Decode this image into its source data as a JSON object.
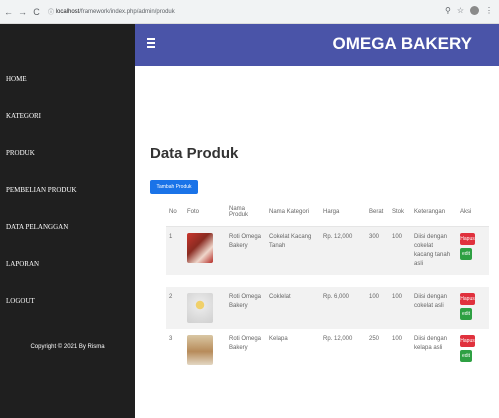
{
  "browser": {
    "url_host": "localhost",
    "url_path": "/framework/index.php/admin/produk"
  },
  "sidebar": {
    "items": [
      {
        "label": "HOME"
      },
      {
        "label": "KATEGORI"
      },
      {
        "label": "PRODUK"
      },
      {
        "label": "PEMBELIAN PRODUK"
      },
      {
        "label": "DATA PELANGGAN"
      },
      {
        "label": "LAPORAN"
      },
      {
        "label": "LOGOUT"
      }
    ],
    "copyright": "Copyright © 2021 By Risma"
  },
  "header": {
    "brand": "OMEGA BAKERY"
  },
  "main": {
    "title": "Data Produk",
    "add_button": "Tambah Produk",
    "table": {
      "headers": [
        "No",
        "Foto",
        "Nama Produk",
        "Nama Kategori",
        "Harga",
        "Berat",
        "Stok",
        "Keterangan",
        "Aksi"
      ],
      "rows": [
        {
          "no": "1",
          "name": "Roti Omega Bakery",
          "category": "Cokelat Kacang Tanah",
          "price": "Rp. 12,000",
          "weight": "300",
          "stock": "100",
          "desc": "Diisi dengan cokelat kacang tanah asli"
        },
        {
          "no": "2",
          "name": "Roti Omega Bakery",
          "category": "Coklelat",
          "price": "Rp. 6,000",
          "weight": "100",
          "stock": "100",
          "desc": "Diisi dengan cokelat asli"
        },
        {
          "no": "3",
          "name": "Roti Omega Bakery",
          "category": "Kelapa",
          "price": "Rp. 12,000",
          "weight": "250",
          "stock": "100",
          "desc": "Diisi dengan kelapa asli"
        }
      ],
      "action_delete": "Hapus",
      "action_edit": "edit"
    }
  }
}
